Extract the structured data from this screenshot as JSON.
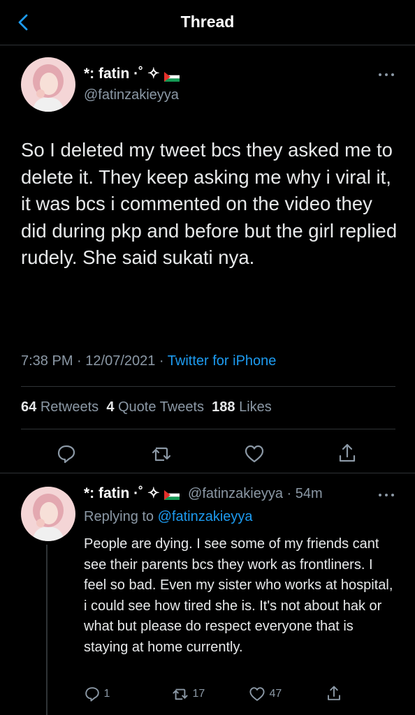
{
  "header": {
    "title": "Thread"
  },
  "main_tweet": {
    "display_name": "*: fatin ·˚ ✧",
    "handle": "@fatinzakieyya",
    "text": "So I deleted my tweet bcs they asked me to delete it. They keep asking me why i viral it, it was bcs i commented on the video they did during pkp and before but the girl replied rudely. She said sukati nya.",
    "time": "7:38 PM",
    "date": "12/07/2021",
    "source": "Twitter for iPhone",
    "retweets_count": "64",
    "retweets_label": "Retweets",
    "quotes_count": "4",
    "quotes_label": "Quote Tweets",
    "likes_count": "188",
    "likes_label": "Likes"
  },
  "reply_tweet": {
    "display_name": "*: fatin ·˚ ✧",
    "handle": "@fatinzakieyya",
    "age": "54m",
    "replying_prefix": "Replying to",
    "replying_handle": "@fatinzakieyya",
    "text": "People are dying. I see some of my friends cant see their parents bcs they work as frontliners. I feel so bad. Even my sister who works at hospital, i could see how tired she is. It's not about hak or what but please do respect everyone that is staying at home currently.",
    "reply_count": "1",
    "retweet_count": "17",
    "like_count": "47"
  },
  "colors": {
    "accent": "#1d9bf0",
    "background": "#000000",
    "secondary_text": "#8b98a5"
  },
  "icons": [
    "back-chevron-icon",
    "more-icon",
    "reply-icon",
    "retweet-icon",
    "like-icon",
    "share-icon",
    "palestine-flag-icon"
  ]
}
